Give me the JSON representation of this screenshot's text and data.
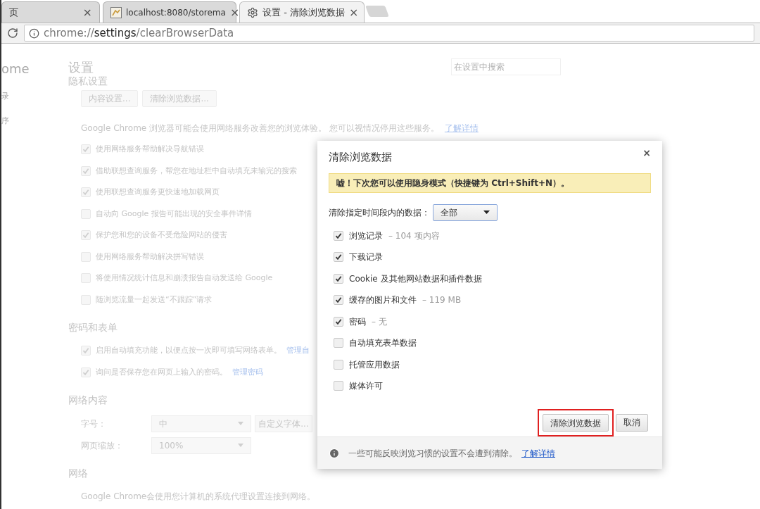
{
  "tabs": [
    {
      "title": "页",
      "kind": "plain",
      "close": "×",
      "selected": false
    },
    {
      "title": "localhost:8080/storema",
      "kind": "image",
      "close": "×",
      "selected": false
    },
    {
      "title": "设置 - 清除浏览数据",
      "kind": "settings",
      "close": "×",
      "selected": true
    }
  ],
  "address": {
    "scheme": "chrome://",
    "host": "settings",
    "path": "/clearBrowserData"
  },
  "sidebar": {
    "items": [
      "ome",
      "录",
      "序"
    ]
  },
  "settings": {
    "title": "设置",
    "search_placeholder": "在设置中搜索",
    "sections": [
      {
        "heading": "隐私设置",
        "items": [
          {
            "kind": "buttons",
            "buttons": [
              "内容设置...",
              "清除浏览数据..."
            ]
          },
          {
            "kind": "text",
            "text": "Google Chrome 浏览器可能会使用网络服务改善您的浏览体验。 您可以视情况停用这些服务。",
            "link": "了解详情"
          },
          {
            "kind": "checkbox",
            "label": "使用网络服务帮助解决导航错误",
            "checked": true
          },
          {
            "kind": "checkbox",
            "label": "借助联想查询服务，帮您在地址栏中自动填充未输完的搜索",
            "checked": true
          },
          {
            "kind": "checkbox",
            "label": "使用联想查询服务更快速地加载网页",
            "checked": true
          },
          {
            "kind": "checkbox",
            "label": "自动向 Google 报告可能出现的安全事件详情",
            "checked": false
          },
          {
            "kind": "checkbox",
            "label": "保护您和您的设备不受危险网站的侵害",
            "checked": true
          },
          {
            "kind": "checkbox",
            "label": "使用网络服务帮助解决拼写错误",
            "checked": false
          },
          {
            "kind": "checkbox",
            "label": "将使用情况统计信息和崩溃报告自动发送给 Google",
            "checked": false
          },
          {
            "kind": "checkbox",
            "label": "随浏览流量一起发送“不跟踪”请求",
            "checked": false
          }
        ]
      },
      {
        "heading": "密码和表单",
        "items": [
          {
            "kind": "checkbox",
            "label": "启用自动填充功能，以便点按一次即可填写网络表单。",
            "checked": true,
            "link": "管理自"
          },
          {
            "kind": "checkbox",
            "label": "询问是否保存您在网页上输入的密码。",
            "checked": true,
            "link": "管理密码"
          }
        ]
      },
      {
        "heading": "网络内容",
        "items": [
          {
            "kind": "select",
            "label": "字号：",
            "value": "中",
            "button": "自定义字体..."
          },
          {
            "kind": "select",
            "label": "网页缩放：",
            "value": "100%"
          }
        ]
      },
      {
        "heading": "网络",
        "items": [
          {
            "kind": "text",
            "text": "Google Chrome会使用您计算机的系统代理设置连接到网络。"
          }
        ]
      }
    ]
  },
  "dialog": {
    "title": "清除浏览数据",
    "close": "×",
    "notice": "嘘！下次您可以使用隐身模式（快捷键为 Ctrl+Shift+N）。",
    "range": {
      "label": "清除指定时间段内的数据：",
      "value": "全部"
    },
    "options": [
      {
        "label": "浏览记录",
        "detail": "– 104 项内容",
        "checked": true
      },
      {
        "label": "下载记录",
        "checked": true
      },
      {
        "label": "Cookie 及其他网站数据和插件数据",
        "checked": true
      },
      {
        "label": "缓存的图片和文件",
        "detail": "– 119 MB",
        "checked": true
      },
      {
        "label": "密码",
        "detail": "– 无",
        "checked": true
      },
      {
        "label": "自动填充表单数据",
        "checked": false
      },
      {
        "label": "托管应用数据",
        "checked": false
      },
      {
        "label": "媒体许可",
        "checked": false
      }
    ],
    "buttons": [
      {
        "label": "清除浏览数据",
        "highlighted": true
      },
      {
        "label": "取消",
        "highlighted": false
      }
    ],
    "footer": {
      "text": "一些可能反映浏览习惯的设置不会遭到清除。",
      "link": "了解详情"
    }
  }
}
